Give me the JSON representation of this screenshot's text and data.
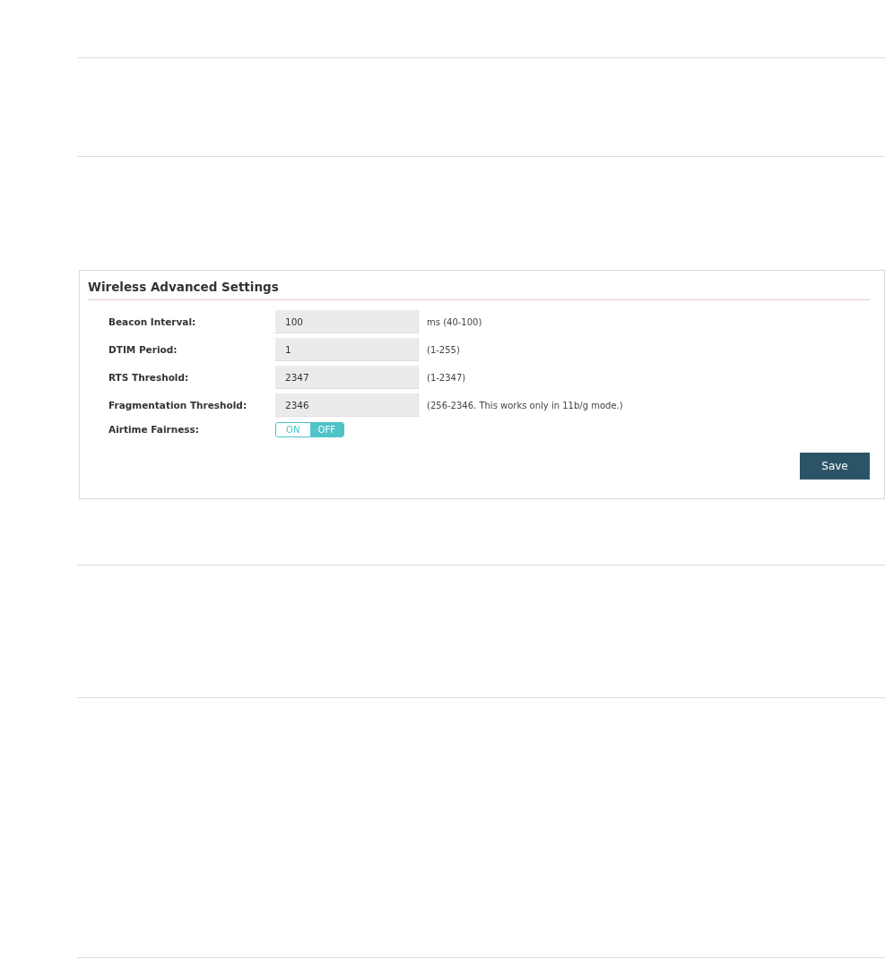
{
  "panel": {
    "title": "Wireless Advanced Settings",
    "fields": [
      {
        "kind": "text",
        "label": "Beacon Interval:",
        "value": "100",
        "hint": "ms (40-100)"
      },
      {
        "kind": "text",
        "label": "DTIM Period:",
        "value": "1",
        "hint": "(1-255)"
      },
      {
        "kind": "text",
        "label": "RTS Threshold:",
        "value": "2347",
        "hint": "(1-2347)"
      },
      {
        "kind": "text",
        "label": "Fragmentation Threshold:",
        "value": "2346",
        "hint": "(256-2346. This works only in 11b/g mode.)"
      },
      {
        "kind": "toggle",
        "label": "Airtime Fairness:",
        "options": [
          {
            "label": "ON",
            "selected": false
          },
          {
            "label": "OFF",
            "selected": true
          }
        ]
      }
    ],
    "save_button": "Save"
  }
}
